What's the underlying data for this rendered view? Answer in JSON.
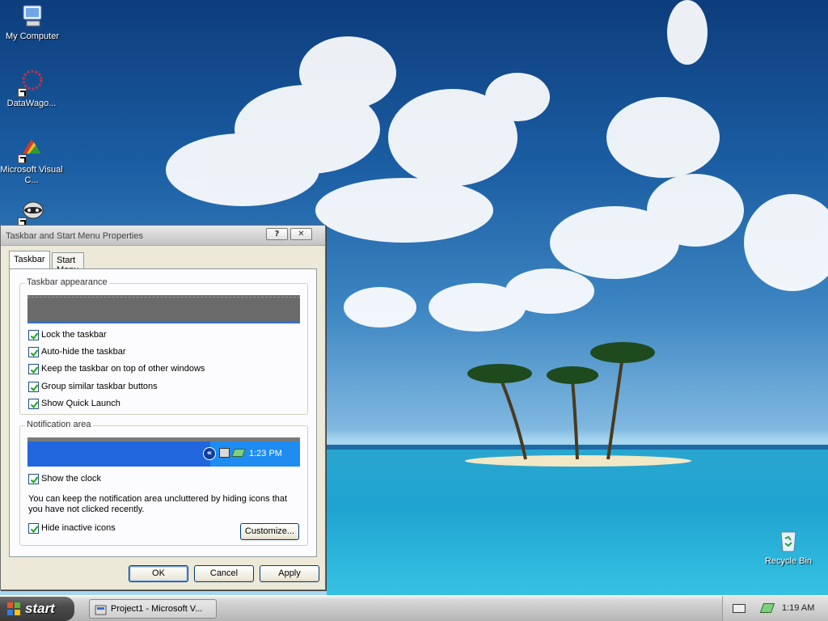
{
  "desktop": {
    "icons": [
      {
        "label": "My Computer",
        "icon": "my-computer-icon"
      },
      {
        "label": "DataWago...",
        "icon": "datawagon-icon"
      },
      {
        "label": "Microsoft Visual C...",
        "icon": "visual-c-icon"
      },
      {
        "label": "",
        "icon": "raccoon-icon"
      },
      {
        "label": "Recycle Bin",
        "icon": "recycle-bin-icon"
      }
    ]
  },
  "dialog": {
    "title": "Taskbar and Start Menu Properties",
    "help_glyph": "?",
    "close_glyph": "✕",
    "tabs": [
      {
        "label": "Taskbar",
        "active": true
      },
      {
        "label": "Start Menu",
        "active": false
      }
    ],
    "appearance": {
      "title": "Taskbar appearance",
      "options": [
        {
          "label": "Lock the taskbar",
          "checked": true
        },
        {
          "label": "Auto-hide the taskbar",
          "checked": true
        },
        {
          "label": "Keep the taskbar on top of other windows",
          "checked": true
        },
        {
          "label": "Group similar taskbar buttons",
          "checked": true
        },
        {
          "label": "Show Quick Launch",
          "checked": true
        }
      ]
    },
    "notification": {
      "title": "Notification area",
      "preview_time": "1:23 PM",
      "show_clock": {
        "label": "Show the clock",
        "checked": true
      },
      "hint": "You can keep the notification area uncluttered by hiding icons that you have not clicked recently.",
      "hide_inactive": {
        "label": "Hide inactive icons",
        "checked": true
      },
      "customize_label": "Customize..."
    },
    "buttons": {
      "ok": "OK",
      "cancel": "Cancel",
      "apply": "Apply"
    }
  },
  "taskbar": {
    "start_label": "start",
    "task_item": "Project1 - Microsoft V...",
    "clock": "1:19 AM"
  },
  "colors": {
    "preview_blue": "#2266dd",
    "dialog_bg": "#ece9d8"
  }
}
